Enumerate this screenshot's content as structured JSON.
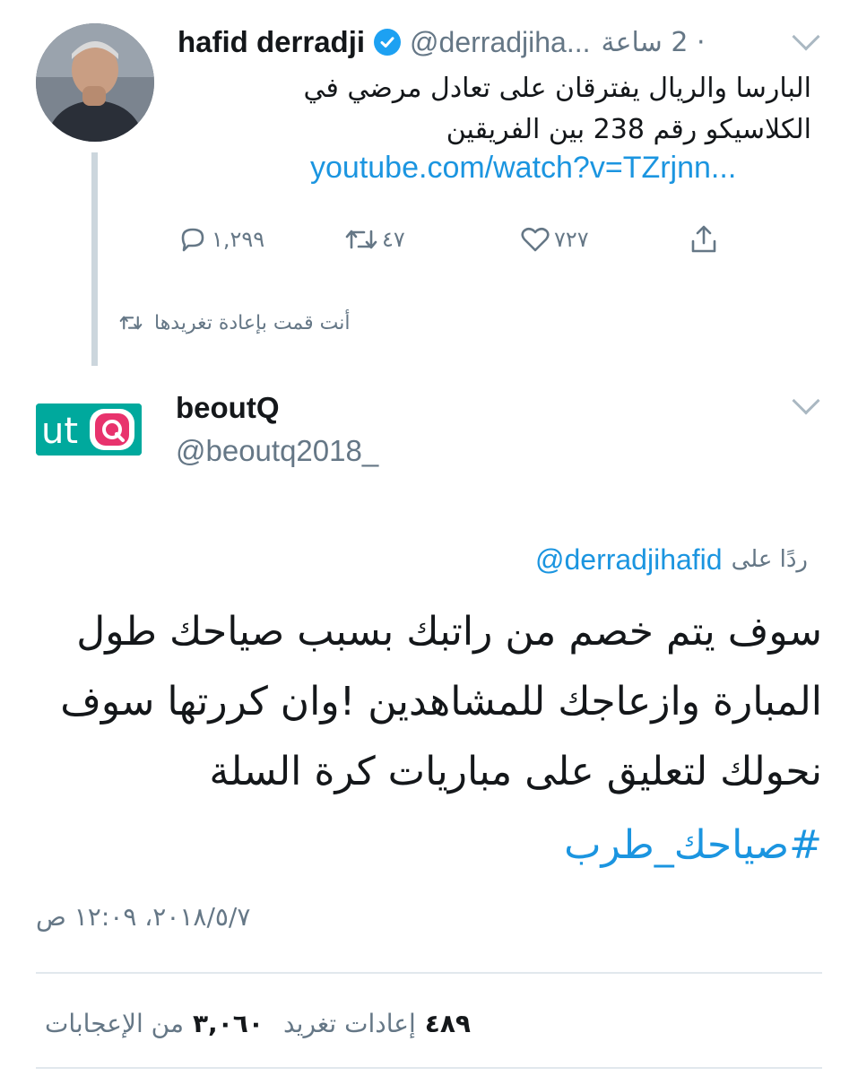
{
  "quoted_tweet": {
    "name": "hafid derradji",
    "handle": "@derradjiha...",
    "time": "· 2 ساعة",
    "text_line1": "البارسا والريال يفترقان على تعادل مرضي في",
    "text_line2": "الكلاسيكو رقم 238 بين الفريقين",
    "link": "youtube.com/watch?v=TZrjnn...",
    "replies": "١,٢٩٩",
    "retweets": "٤٧",
    "likes": "٧٢٧",
    "retweeted_label": "أنت قمت بإعادة تغريدها"
  },
  "main_tweet": {
    "name": "beoutQ",
    "handle": "@beoutq2018_",
    "reply_label": "ردًا على",
    "reply_handle": "@derradjihafid",
    "text_line1": "سوف يتم خصم من راتبك بسبب صياحك طول",
    "text_line2": "المبارة وازعاجك للمشاهدين !وان كررتها سوف",
    "text_line3": "نحولك لتعليق على مباريات كرة السلة",
    "hashtag": "#صياحك_طرب",
    "timestamp": "٢٠١٨/٥/٧، ١٢:٠٩ ص",
    "retweets_count": "٤٨٩",
    "retweets_label": "إعادات تغريد",
    "likes_count": "٣,٠٦٠",
    "likes_label": "من الإعجابات"
  },
  "colors": {
    "link": "#1b95e0",
    "muted": "#657786",
    "verified": "#1da1f2",
    "logo_bg": "#00a99d",
    "logo_accent": "#e8336d"
  },
  "icons": [
    "verified-badge-icon",
    "chevron-down-icon",
    "reply-icon",
    "retweet-icon",
    "like-icon",
    "share-icon",
    "beoutq-logo"
  ]
}
